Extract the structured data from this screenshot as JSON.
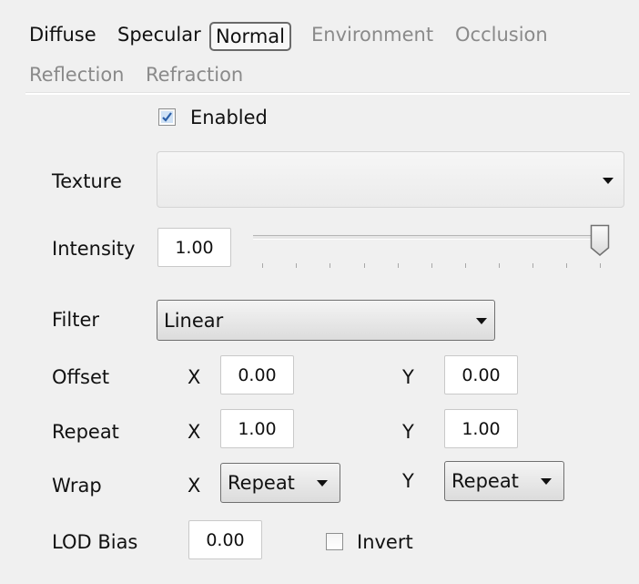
{
  "tabs": [
    {
      "label": "Diffuse",
      "state": "enabled"
    },
    {
      "label": "Specular",
      "state": "enabled"
    },
    {
      "label": "Normal",
      "state": "selected"
    },
    {
      "label": "Environment",
      "state": "disabled"
    },
    {
      "label": "Occlusion",
      "state": "disabled"
    },
    {
      "label": "Reflection",
      "state": "disabled"
    },
    {
      "label": "Refraction",
      "state": "disabled"
    }
  ],
  "enabled": {
    "label": "Enabled",
    "checked": true
  },
  "texture": {
    "label": "Texture",
    "value": ""
  },
  "intensity": {
    "label": "Intensity",
    "value": "1.00",
    "slider_fraction": 1.0
  },
  "filter": {
    "label": "Filter",
    "value": "Linear"
  },
  "offset": {
    "label": "Offset",
    "x_label": "X",
    "x_value": "0.00",
    "y_label": "Y",
    "y_value": "0.00"
  },
  "repeat": {
    "label": "Repeat",
    "x_label": "X",
    "x_value": "1.00",
    "y_label": "Y",
    "y_value": "1.00"
  },
  "wrap": {
    "label": "Wrap",
    "x_label": "X",
    "x_value": "Repeat",
    "y_label": "Y",
    "y_value": "Repeat"
  },
  "lod_bias": {
    "label": "LOD Bias",
    "value": "0.00"
  },
  "invert": {
    "label": "Invert",
    "checked": false
  },
  "colors": {
    "background": "#f0f0f0",
    "disabled_text": "#8a8a8a",
    "check_accent": "#2b5fa8"
  }
}
